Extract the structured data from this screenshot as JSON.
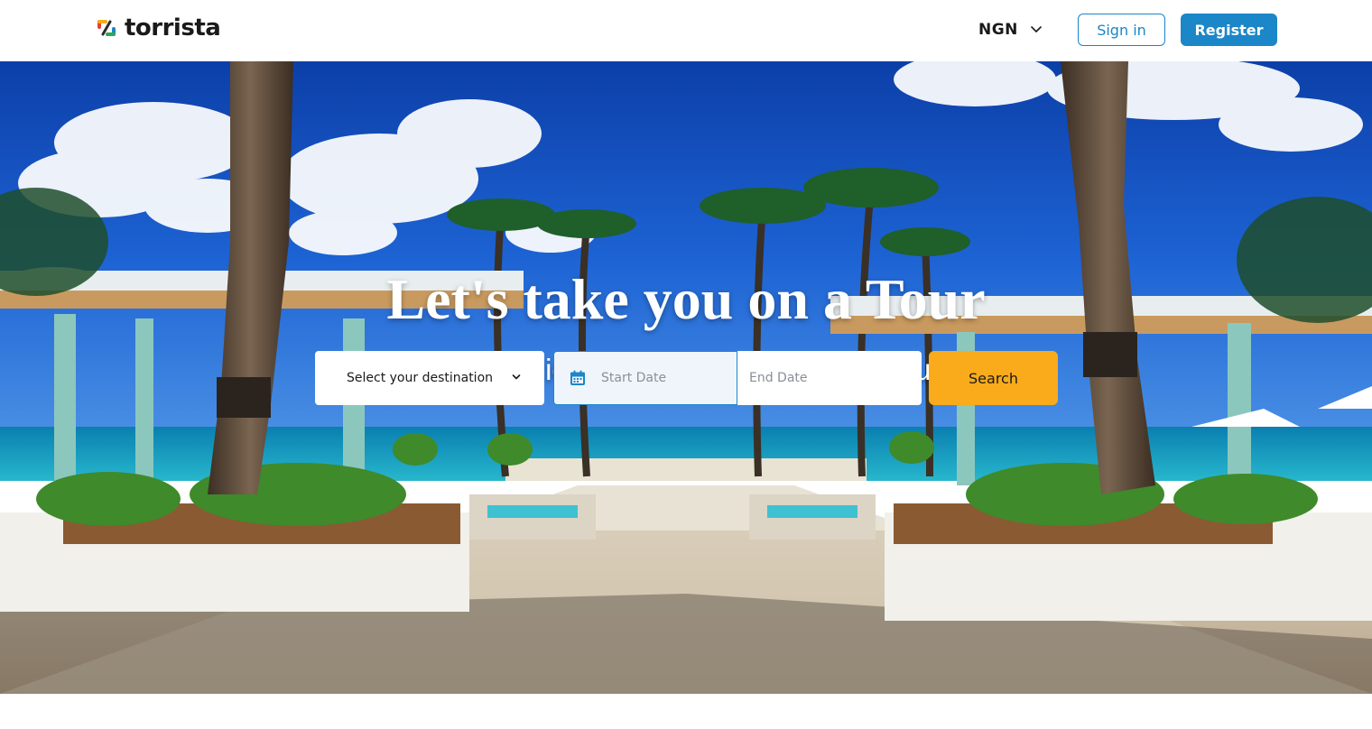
{
  "header": {
    "logo_text": "torrista",
    "currency": "NGN",
    "signin_label": "Sign in",
    "register_label": "Register"
  },
  "hero": {
    "title": "Let's take you on a Tour",
    "subtitle": "Explore Rich African Culture & Adventure"
  },
  "search": {
    "destination_label": "Select your destination",
    "start_placeholder": "Start Date",
    "end_placeholder": "End Date",
    "search_label": "Search"
  },
  "colors": {
    "brand_blue": "#1b86c8",
    "search_orange": "#f9ab1b",
    "date_field_bg": "#f0f5fb"
  },
  "icons": {
    "logo": "torrista-logo-icon",
    "currency_chevron": "chevron-down-icon",
    "destination_chevron": "chevron-down-icon",
    "calendar": "calendar-icon"
  }
}
